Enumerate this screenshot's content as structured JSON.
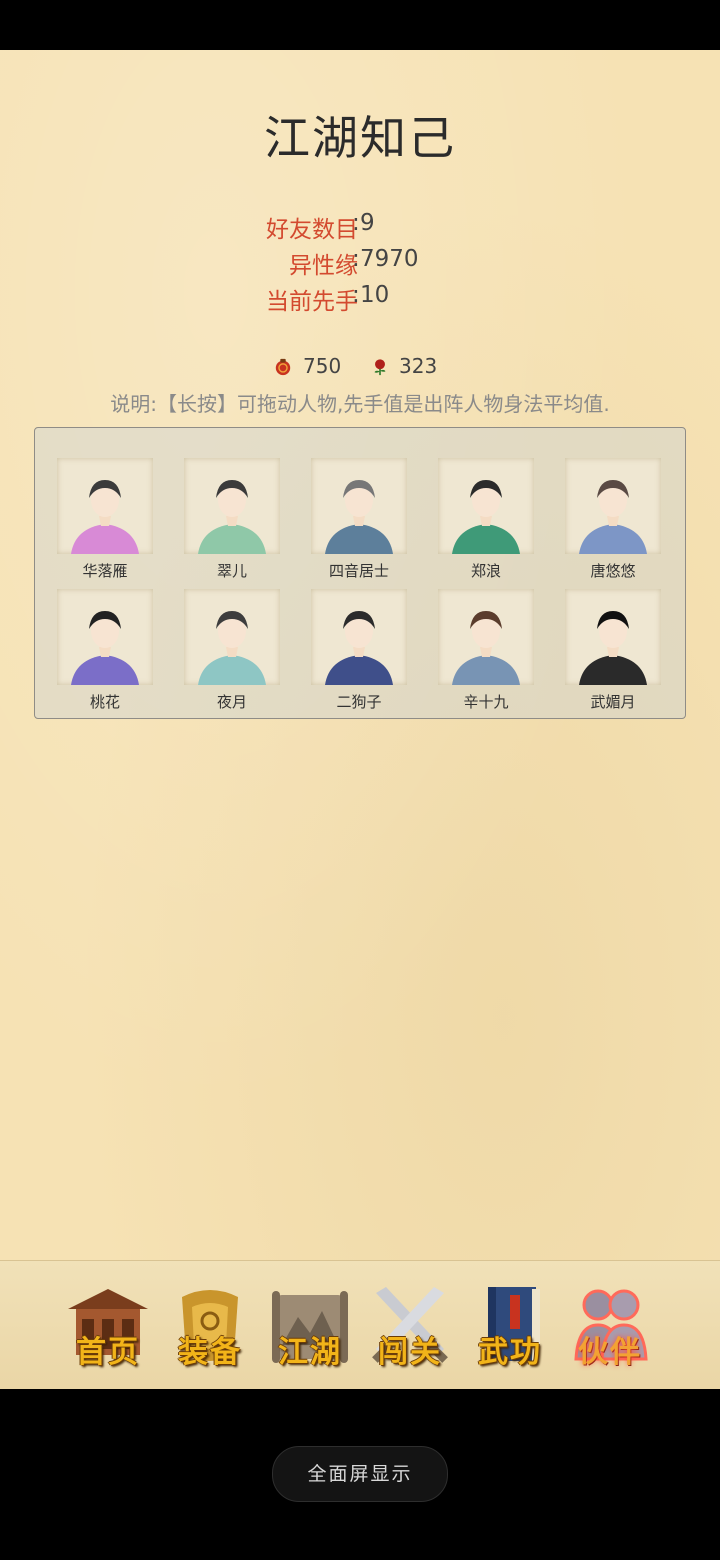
{
  "page": {
    "title": "江湖知己"
  },
  "stats": [
    {
      "label": "好友数目",
      "value": "9"
    },
    {
      "label": "异性缘",
      "value": "7970"
    },
    {
      "label": "当前先手",
      "value": "10"
    }
  ],
  "currency": {
    "items": [
      {
        "icon": "red-orb-icon",
        "value": "750",
        "color": "#c8331f"
      },
      {
        "icon": "rose-icon",
        "value": "323",
        "color": "#b0201b"
      }
    ]
  },
  "hint": "说明:【长按】可拖动人物,先手值是出阵人物身法平均值.",
  "characters": [
    {
      "name": "华落雁",
      "robe": "#d88ad6",
      "hair": "#3b3b3b"
    },
    {
      "name": "翠儿",
      "robe": "#8fc8a8",
      "hair": "#3b3b3b"
    },
    {
      "name": "四音居士",
      "robe": "#5d7f9b",
      "hair": "#777"
    },
    {
      "name": "郑浪",
      "robe": "#3f9a78",
      "hair": "#2b2b2b"
    },
    {
      "name": "唐悠悠",
      "robe": "#7d96c6",
      "hair": "#5a4a44"
    },
    {
      "name": "桃花",
      "robe": "#7b6ec8",
      "hair": "#222"
    },
    {
      "name": "夜月",
      "robe": "#8ec6c4",
      "hair": "#3d3d3d"
    },
    {
      "name": "二狗子",
      "robe": "#3f4f8a",
      "hair": "#2b2b2b"
    },
    {
      "name": "辛十九",
      "robe": "#7894b4",
      "hair": "#5a3c2c"
    },
    {
      "name": "武媚月",
      "robe": "#2a2a2a",
      "hair": "#111"
    }
  ],
  "nav": {
    "items": [
      {
        "label": "首页",
        "icon": "temple-icon"
      },
      {
        "label": "装备",
        "icon": "armor-icon"
      },
      {
        "label": "江湖",
        "icon": "scroll-map-icon"
      },
      {
        "label": "闯关",
        "icon": "crossed-swords-icon"
      },
      {
        "label": "武功",
        "icon": "book-icon"
      },
      {
        "label": "伙伴",
        "icon": "partners-icon",
        "active": true
      }
    ]
  },
  "system": {
    "fullscreen_label": "全面屏显示"
  }
}
